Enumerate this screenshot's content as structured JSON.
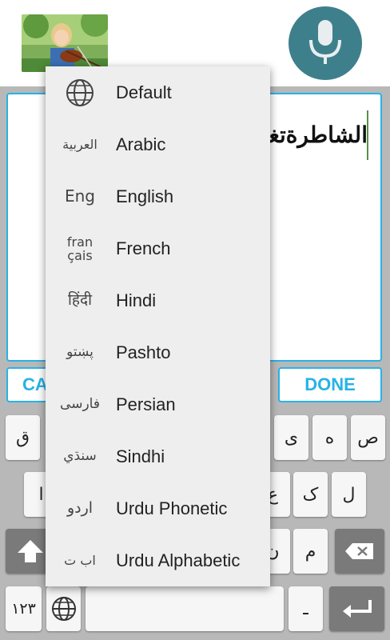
{
  "editor": {
    "text": "الشاطرةتغذ"
  },
  "buttons": {
    "cancel_label": "CA",
    "done_label": "DONE"
  },
  "keys": {
    "row1": [
      "ق",
      "ى",
      "ه",
      "ص"
    ],
    "row2": [
      "ا",
      "ع",
      "ک",
      "ل"
    ],
    "row3": [
      "ن",
      "م"
    ],
    "numbers_label": "۱۲۳",
    "dash_label": "ـ"
  },
  "language_menu": {
    "items": [
      {
        "icon": "globe-icon",
        "icon_text": "",
        "label": "Default"
      },
      {
        "icon": "arabic-script-icon",
        "icon_text": "العربية",
        "label": "Arabic"
      },
      {
        "icon": "english-script-icon",
        "icon_text": "Eng",
        "label": "English"
      },
      {
        "icon": "french-script-icon",
        "icon_text": "fran çais",
        "label": "French"
      },
      {
        "icon": "hindi-script-icon",
        "icon_text": "हिंदी",
        "label": "Hindi"
      },
      {
        "icon": "pashto-script-icon",
        "icon_text": "پښتو",
        "label": "Pashto"
      },
      {
        "icon": "persian-script-icon",
        "icon_text": "فارسی",
        "label": "Persian"
      },
      {
        "icon": "sindhi-script-icon",
        "icon_text": "سنڌي",
        "label": "Sindhi"
      },
      {
        "icon": "urdu-script-icon",
        "icon_text": "اردو",
        "label": "Urdu Phonetic"
      },
      {
        "icon": "urdu-alphabet-icon",
        "icon_text": "اب ت",
        "label": "Urdu Alphabetic"
      }
    ]
  },
  "colors": {
    "accent": "#27b3e6",
    "mic_bg": "#3e7f8c",
    "keyboard_bg": "#b8b8b8",
    "menu_bg": "#eeeeee"
  }
}
